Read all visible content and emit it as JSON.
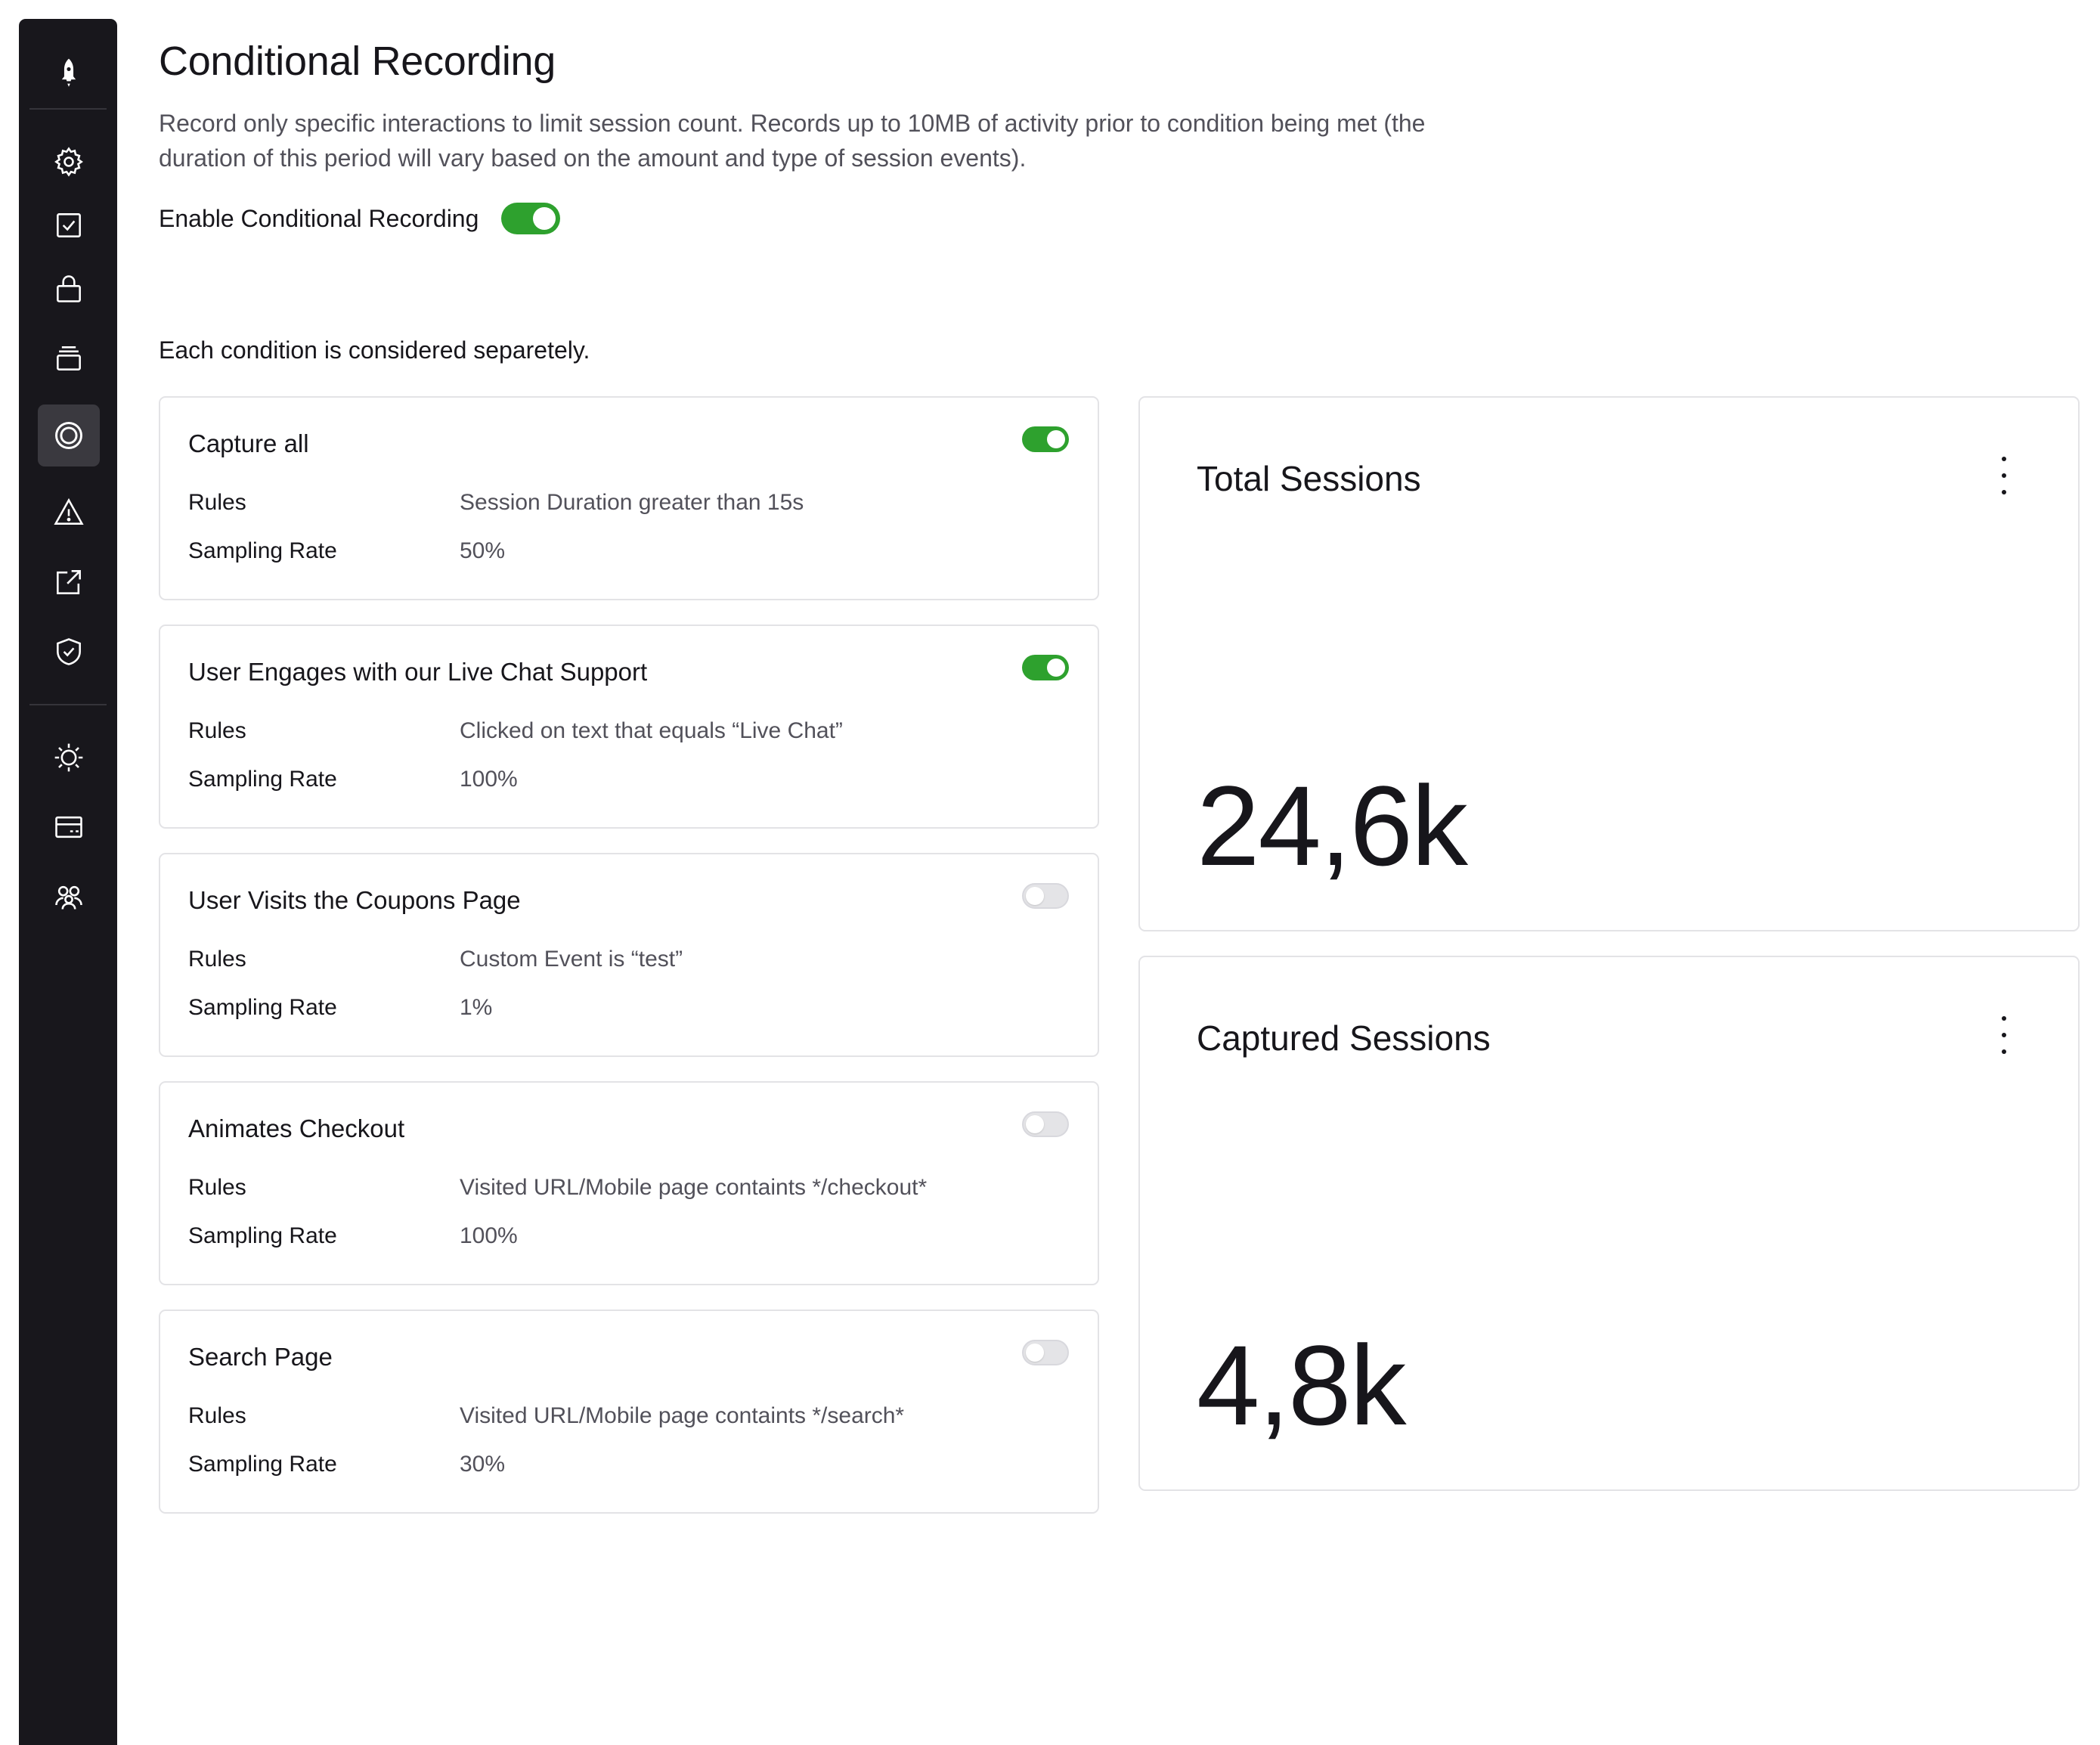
{
  "sidebar": {
    "icons": [
      "rocket-icon",
      "gear-icon",
      "checkbox-icon",
      "lock-icon",
      "stack-icon",
      "target-icon",
      "warning-icon",
      "external-link-icon",
      "shield-check-icon",
      "settings-sun-icon",
      "billing-card-icon",
      "team-icon"
    ],
    "active": "target-icon"
  },
  "header": {
    "title": "Conditional Recording",
    "description": "Record only specific interactions to limit session count. Records up to 10MB of activity prior to condition being met (the duration of this period will vary based on the amount and type of session events).",
    "enable_label": "Enable Conditional Recording",
    "enable_on": true
  },
  "conditions_note": "Each condition is considered separetely.",
  "labels": {
    "rules": "Rules",
    "sampling": "Sampling Rate"
  },
  "conditions": [
    {
      "title": "Capture all",
      "rules": "Session Duration greater than 15s",
      "sampling": "50%",
      "enabled": true
    },
    {
      "title": "User Engages with our Live Chat Support",
      "rules": "Clicked on text that equals “Live Chat”",
      "sampling": "100%",
      "enabled": true
    },
    {
      "title": "User Visits the Coupons Page",
      "rules": "Custom Event is “test”",
      "sampling": "1%",
      "enabled": false
    },
    {
      "title": "Animates Checkout",
      "rules": "Visited URL/Mobile page containts */checkout*",
      "sampling": "100%",
      "enabled": false
    },
    {
      "title": "Search Page",
      "rules": "Visited URL/Mobile page containts */search*",
      "sampling": "30%",
      "enabled": false
    }
  ],
  "metrics": [
    {
      "title": "Total Sessions",
      "value": "24,6k"
    },
    {
      "title": "Captured Sessions",
      "value": "4,8k"
    }
  ],
  "colors": {
    "sidebar_bg": "#18171c",
    "toggle_on": "#2ea12e",
    "border": "#e3e3e6"
  }
}
